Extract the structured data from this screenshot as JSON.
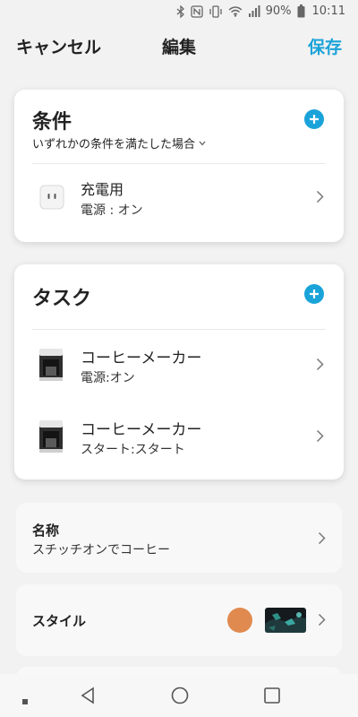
{
  "status_bar": {
    "battery_percent": "90%",
    "time": "10:11"
  },
  "header": {
    "cancel_label": "キャンセル",
    "title": "編集",
    "save_label": "保存"
  },
  "conditions": {
    "title": "条件",
    "match_mode": "いずれかの条件を満たした場合",
    "items": [
      {
        "title": "充電用",
        "subtitle": "電源 : オン",
        "icon": "smart-plug-icon"
      }
    ]
  },
  "tasks": {
    "title": "タスク",
    "items": [
      {
        "title": "コーヒーメーカー",
        "subtitle": "電源:オン",
        "icon": "coffee-maker-icon"
      },
      {
        "title": "コーヒーメーカー",
        "subtitle": "スタート:スタート",
        "icon": "coffee-maker-icon"
      }
    ]
  },
  "name_row": {
    "label": "名称",
    "value": "スチッチオンでコーヒー"
  },
  "style_row": {
    "label": "スタイル",
    "color": "#e08a50"
  },
  "colors": {
    "accent": "#1aa3d9",
    "background": "#f2f2f2"
  }
}
